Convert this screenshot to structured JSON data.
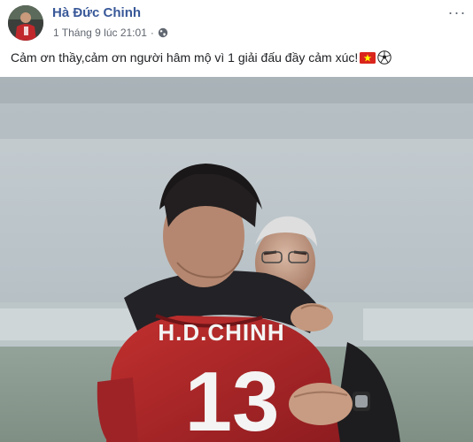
{
  "post": {
    "author": "Hà Đức Chinh",
    "timestamp": "1 Tháng 9 lúc 21:01",
    "separator": "·",
    "privacy_icon": "globe-icon",
    "more_icon": "more-options-icon",
    "more_label": "···",
    "caption": "Cảm ơn thầy,cảm ơn người hâm mộ vì 1 giải đấu đầy cảm xúc!",
    "caption_emojis": [
      "vietnam-flag-icon",
      "soccer-ball-icon"
    ],
    "photo": {
      "jersey_text": "H.D.CHINH",
      "jersey_number": "13"
    }
  },
  "colors": {
    "author_link": "#385898",
    "meta_text": "#616770",
    "jersey_red": "#b3262a",
    "flag_red": "#da251d",
    "flag_star": "#ffff00"
  }
}
